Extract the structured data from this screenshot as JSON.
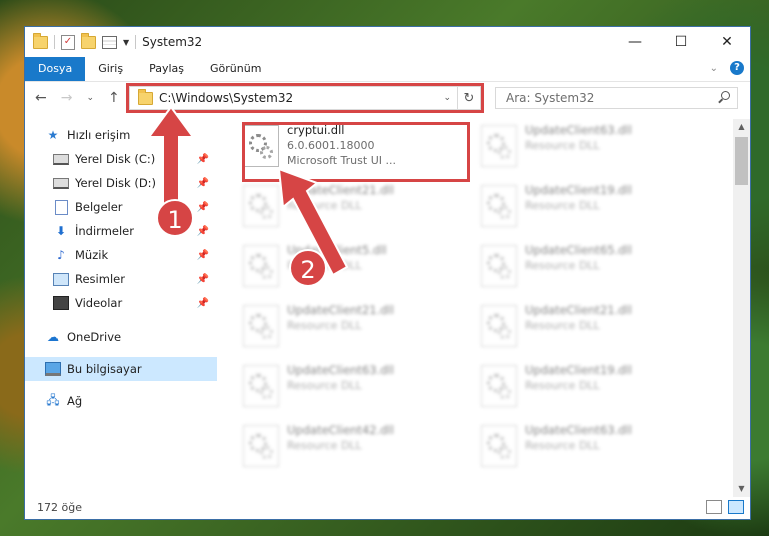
{
  "window": {
    "title": "System32"
  },
  "controls": {
    "minimize": "—",
    "maximize": "☐",
    "close": "✕"
  },
  "ribbon": {
    "tabs": [
      "Dosya",
      "Giriş",
      "Paylaş",
      "Görünüm"
    ],
    "expand": "⌄",
    "help": "?"
  },
  "nav": {
    "back": "←",
    "forward": "→",
    "recent": "⌄",
    "up": "↑"
  },
  "address": {
    "path": "C:\\Windows\\System32",
    "dropdown": "⌄",
    "refresh": "↻"
  },
  "search": {
    "placeholder": "Ara: System32"
  },
  "sidebar": {
    "items": [
      {
        "label": "Hızlı erişim",
        "icon": "star-icon"
      },
      {
        "label": "Yerel Disk (C:)",
        "icon": "drive-icon",
        "pinned": true
      },
      {
        "label": "Yerel Disk (D:)",
        "icon": "drive-icon",
        "pinned": true
      },
      {
        "label": "Belgeler",
        "icon": "document-icon",
        "pinned": true
      },
      {
        "label": "İndirmeler",
        "icon": "download-icon",
        "pinned": true
      },
      {
        "label": "Müzik",
        "icon": "music-icon",
        "pinned": true
      },
      {
        "label": "Resimler",
        "icon": "pictures-icon",
        "pinned": true
      },
      {
        "label": "Videolar",
        "icon": "video-icon",
        "pinned": true
      },
      {
        "label": "OneDrive",
        "icon": "cloud-icon"
      },
      {
        "label": "Bu bilgisayar",
        "icon": "computer-icon",
        "selected": true
      },
      {
        "label": "Ağ",
        "icon": "network-icon"
      }
    ],
    "pin_glyph": "📌"
  },
  "files": [
    {
      "name": "cryptui.dll",
      "line2": "6.0.6001.18000",
      "line3": "Microsoft Trust UI ..."
    },
    {
      "name": "UpdateClient63.dll",
      "line2": "Resource DLL"
    },
    {
      "name": "UpdateClient21.dll",
      "line2": "Resource DLL"
    },
    {
      "name": "UpdateClient19.dll",
      "line2": "Resource DLL"
    },
    {
      "name": "UpdateClient5.dll",
      "line2": "Resource DLL"
    },
    {
      "name": "UpdateClient65.dll",
      "line2": "Resource DLL"
    },
    {
      "name": "UpdateClient21.dll",
      "line2": "Resource DLL"
    },
    {
      "name": "UpdateClient21.dll",
      "line2": "Resource DLL"
    },
    {
      "name": "UpdateClient63.dll",
      "line2": "Resource DLL"
    },
    {
      "name": "UpdateClient19.dll",
      "line2": "Resource DLL"
    },
    {
      "name": "UpdateClient42.dll",
      "line2": "Resource DLL"
    },
    {
      "name": "UpdateClient63.dll",
      "line2": "Resource DLL"
    }
  ],
  "status": {
    "count": "172 öğe"
  },
  "annotations": {
    "step1": "1",
    "step2": "2"
  },
  "colors": {
    "accent": "#1979ca",
    "annotation": "#d64545"
  }
}
